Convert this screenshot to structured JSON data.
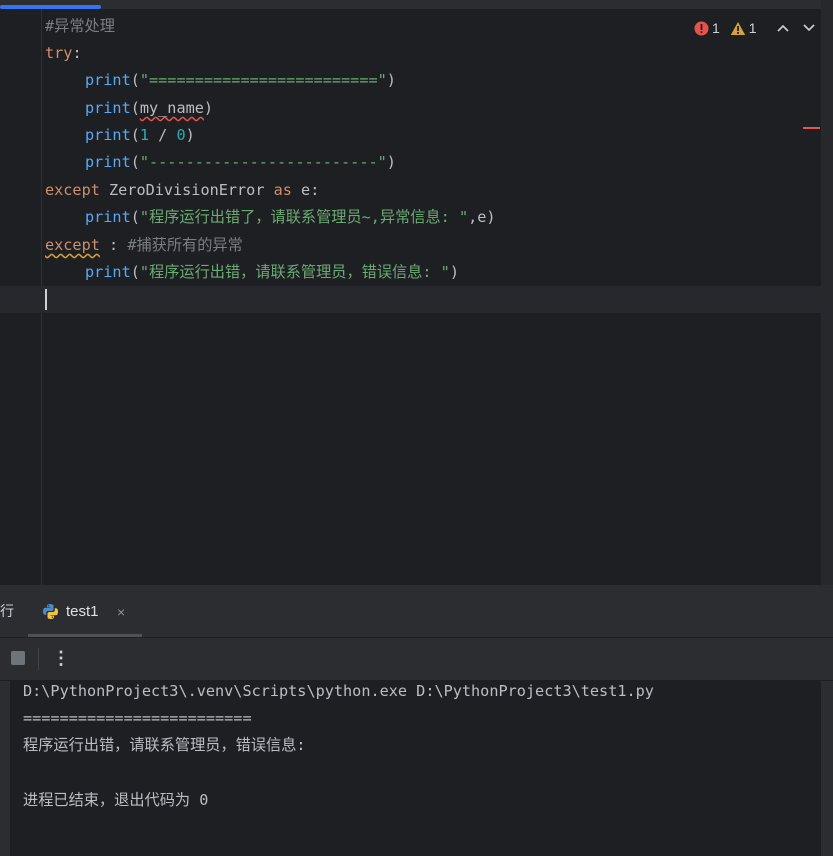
{
  "editor": {
    "lines": {
      "l1_comment": "#异常处理",
      "l2_try": "try",
      "l2_colon": ":",
      "l3_print": "print",
      "l3_open": "(",
      "l3_str": "\"=========================\"",
      "l3_close": ")",
      "l4_print": "print",
      "l4_open": "(",
      "l4_arg": "my_name",
      "l4_close": ")",
      "l5_print": "print",
      "l5_open": "(",
      "l5_num1": "1",
      "l5_op": " / ",
      "l5_num2": "0",
      "l5_close": ")",
      "l6_print": "print",
      "l6_open": "(",
      "l6_str": "\"-------------------------\"",
      "l6_close": ")",
      "l7_except": "except",
      "l7_cls": " ZeroDivisionError ",
      "l7_as": "as",
      "l7_var": " e:",
      "l8_print": "print",
      "l8_open": "(",
      "l8_str": "\"程序运行出错了，请联系管理员~,异常信息: \"",
      "l8_rest": ",e)",
      "l9_except": "except",
      "l9_colon": " : ",
      "l9_comment": "#捕获所有的异常",
      "l10_print": "print",
      "l10_open": "(",
      "l10_str": "\"程序运行出错，请联系管理员，错误信息: \"",
      "l10_close": ")"
    },
    "inspections": {
      "errors": "1",
      "warnings": "1",
      "colors": {
        "error": "#e5534b",
        "warning": "#d6a23b"
      }
    }
  },
  "run_panel": {
    "tool_label": "行",
    "tab_label": "test1",
    "tab_close": "×",
    "more_label": "⋮",
    "console_lines": [
      "D:\\PythonProject3\\.venv\\Scripts\\python.exe D:\\PythonProject3\\test1.py",
      "=========================",
      "程序运行出错，请联系管理员，错误信息: ",
      "",
      "进程已结束，退出代码为 0"
    ]
  },
  "icons": {
    "error": "error-circle-icon",
    "warning": "warning-triangle-icon",
    "up": "chevron-up-icon",
    "down": "chevron-down-icon",
    "python": "python-icon",
    "stop": "stop-icon",
    "more": "more-vertical-icon"
  }
}
